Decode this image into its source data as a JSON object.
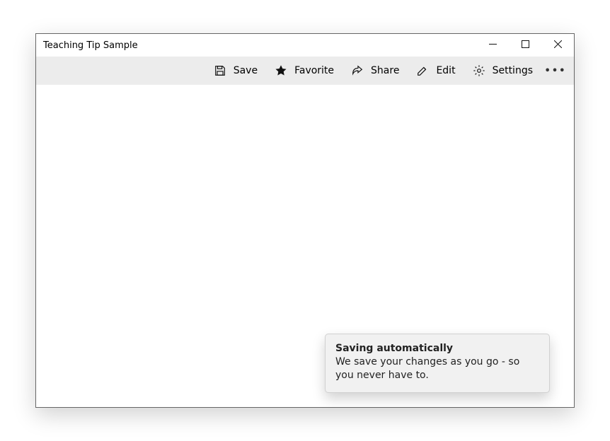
{
  "window": {
    "title": "Teaching Tip Sample"
  },
  "commandbar": {
    "save": "Save",
    "favorite": "Favorite",
    "share": "Share",
    "edit": "Edit",
    "settings": "Settings"
  },
  "teaching_tip": {
    "title": "Saving automatically",
    "body": "We save your changes as you go - so you never have to."
  }
}
